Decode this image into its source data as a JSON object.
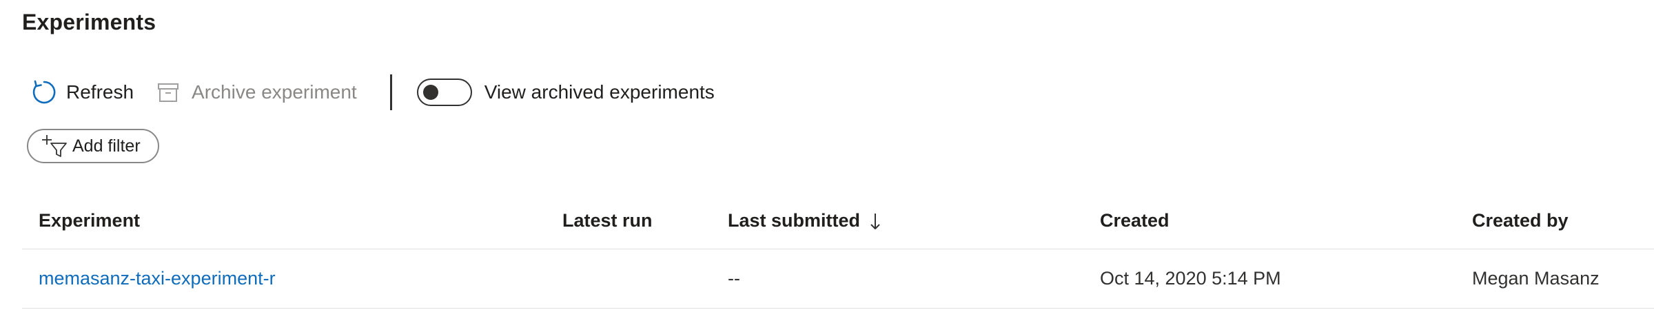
{
  "page": {
    "title": "Experiments"
  },
  "toolbar": {
    "refresh_label": "Refresh",
    "archive_label": "Archive experiment",
    "toggle_label": "View archived experiments",
    "toggle_on": false
  },
  "filter": {
    "add_filter_label": "Add filter"
  },
  "table": {
    "columns": [
      "Experiment",
      "Latest run",
      "Last submitted",
      "Created",
      "Created by"
    ],
    "sort": {
      "column": "Last submitted",
      "direction": "descending"
    },
    "rows": [
      {
        "experiment": "memasanz-taxi-experiment-r",
        "latest_run": "",
        "last_submitted": "--",
        "created": "Oct 14, 2020 5:14 PM",
        "created_by": "Megan Masanz"
      }
    ]
  },
  "colors": {
    "accent": "#0f6cbd",
    "text": "#201f1e",
    "disabled": "#8a8886",
    "divider": "#e1dfdd"
  },
  "icons": {
    "refresh": "refresh-icon",
    "archive": "archive-icon",
    "filter": "add-filter-icon",
    "sort": "arrow-down-icon"
  }
}
